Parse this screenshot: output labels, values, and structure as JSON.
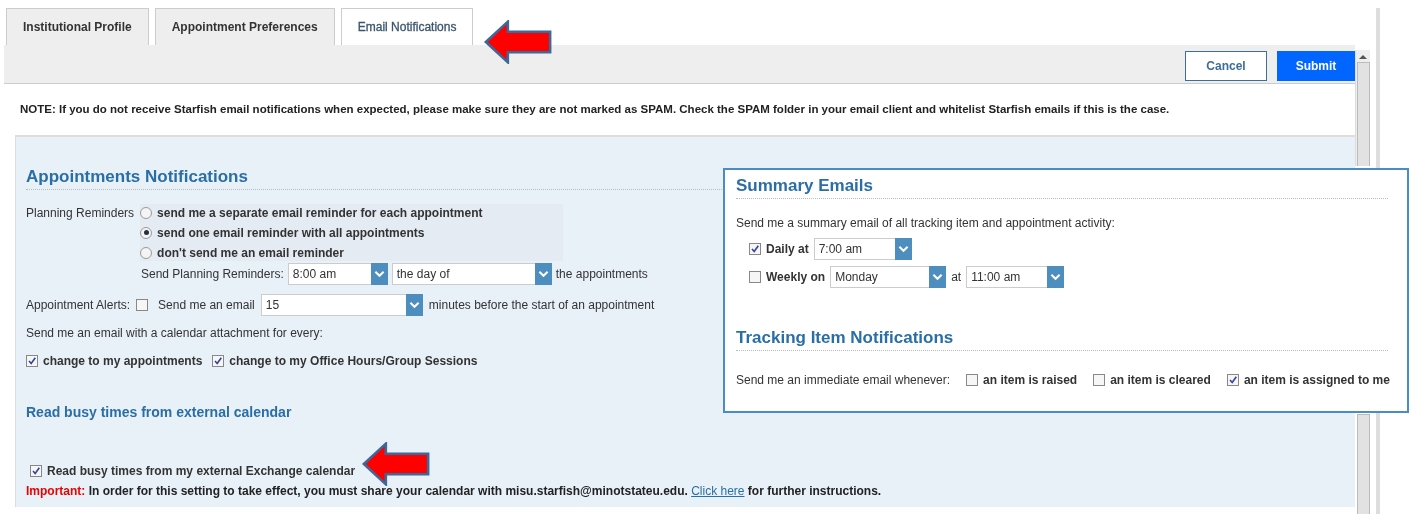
{
  "tabs": [
    {
      "label": "Institutional Profile",
      "selected": false
    },
    {
      "label": "Appointment Preferences",
      "selected": false
    },
    {
      "label": "Email Notifications",
      "selected": true
    }
  ],
  "toolbar": {
    "buttons": [
      {
        "label": "Cancel",
        "kind": "secondary"
      },
      {
        "label": "Submit",
        "kind": "primary"
      }
    ]
  },
  "note": "NOTE: If you do not receive Starfish email notifications when expected, please make sure they are not marked as SPAM. Check the SPAM folder in your email client and whitelist Starfish emails if this is the case.",
  "appointments": {
    "title": "Appointments Notifications",
    "planning": {
      "label": "Planning Reminders",
      "options": [
        {
          "label": "send me a separate email reminder for each appointment",
          "selected": false
        },
        {
          "label": "send one email reminder with all appointments",
          "selected": true
        },
        {
          "label": "don't send me an email reminder",
          "selected": false
        }
      ],
      "send_label": "Send Planning Reminders:",
      "time": "8:00 am",
      "day": "the day of",
      "suffix": "the appointments"
    },
    "alerts": {
      "label": "Appointment Alerts:",
      "checked": false,
      "prefix": "Send me an  email",
      "minutes": "15",
      "suffix": "minutes before the start of an appointment"
    },
    "attachment": {
      "label": "Send me an email with a calendar attachment for every:",
      "options": [
        {
          "label": "change to my appointments",
          "checked": true
        },
        {
          "label": "change to my Office Hours/Group Sessions",
          "checked": true
        }
      ]
    }
  },
  "external": {
    "title": "Read busy times from external calendar",
    "option": {
      "label": "Read busy times from my external Exchange calendar",
      "checked": true
    },
    "important": {
      "label": "Important:",
      "text": " In order for this setting to take effect, you must share your calendar with misu.starfish@minotstateu.edu. ",
      "link": "Click here",
      "after": " for further instructions."
    }
  },
  "summary": {
    "title": "Summary Emails",
    "intro": "Send me a summary email of all tracking item and appointment activity:",
    "daily": {
      "label": "Daily at",
      "checked": true,
      "time": "7:00 am"
    },
    "weekly": {
      "label": "Weekly on",
      "checked": false,
      "day": "Monday",
      "at": "at",
      "time": "11:00 am"
    }
  },
  "tracking": {
    "title": "Tracking Item Notifications",
    "label": "Send me an immediate email whenever:",
    "options": [
      {
        "label": "an item is raised",
        "checked": false
      },
      {
        "label": "an item is cleared",
        "checked": false
      },
      {
        "label": "an item is assigned to me",
        "checked": true
      }
    ]
  }
}
